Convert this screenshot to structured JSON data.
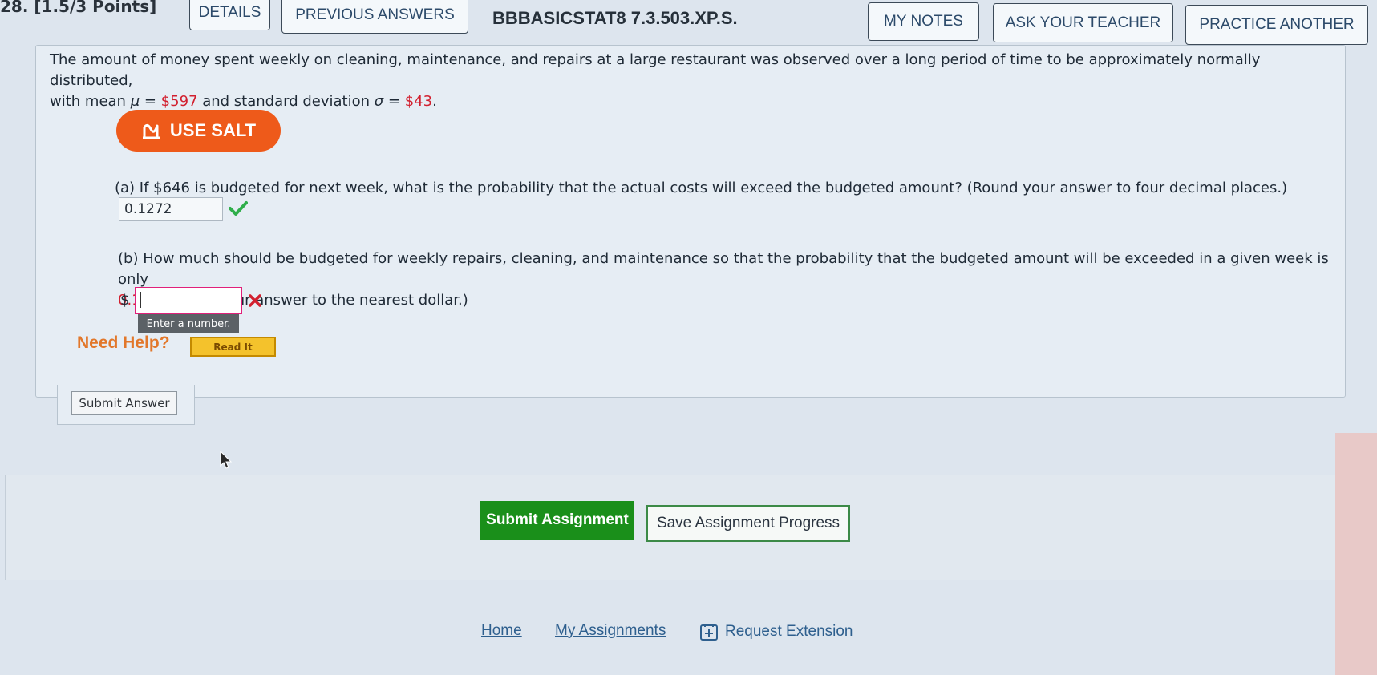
{
  "header": {
    "question_number": "28.",
    "points": "[1.5/3 Points]",
    "tabs": {
      "details": "DETAILS",
      "previous_answers": "PREVIOUS ANSWERS",
      "my_notes": "MY NOTES",
      "ask_teacher": "ASK YOUR TEACHER",
      "practice_another": "PRACTICE ANOTHER"
    },
    "problem_code": "BBBASICSTAT8 7.3.503.XP.S."
  },
  "problem": {
    "intro_line1": "The amount of money spent weekly on cleaning, maintenance, and repairs at a large restaurant was observed over a long period of time to be approximately normally distributed,",
    "intro_with_mean": "with mean ",
    "mu_symbol": "μ",
    "eq1": " = ",
    "mean_value": "$597",
    "intro_and_sd": " and standard deviation ",
    "sigma_symbol": "σ",
    "eq2": " = ",
    "sd_value": "$43",
    "period": ".",
    "salt_button": "USE SALT",
    "part_a": {
      "prompt": "(a) If $646 is budgeted for next week, what is the probability that the actual costs will exceed the budgeted amount? (Round your answer to four decimal places.)",
      "answer": "0.1272"
    },
    "part_b": {
      "prompt_line1": "(b) How much should be budgeted for weekly repairs, cleaning, and maintenance so that the probability that the budgeted amount will be exceeded in a given week is only",
      "prob_value": "0.16",
      "prompt_rest": "? (Round your answer to the nearest dollar.)",
      "currency": "$",
      "answer": "",
      "tooltip": "Enter a number."
    },
    "need_help": "Need Help?",
    "read_it": "Read It",
    "submit_answer": "Submit Answer"
  },
  "footer": {
    "submit_assignment": "Submit Assignment",
    "save_progress": "Save Assignment Progress",
    "home": "Home",
    "my_assignments": "My Assignments",
    "request_extension": "Request Extension"
  },
  "colors": {
    "accent_orange": "#ee5a1a",
    "correct_green": "#2fae4a",
    "wrong_red": "#d2202f",
    "submit_green": "#1a8f1a"
  }
}
